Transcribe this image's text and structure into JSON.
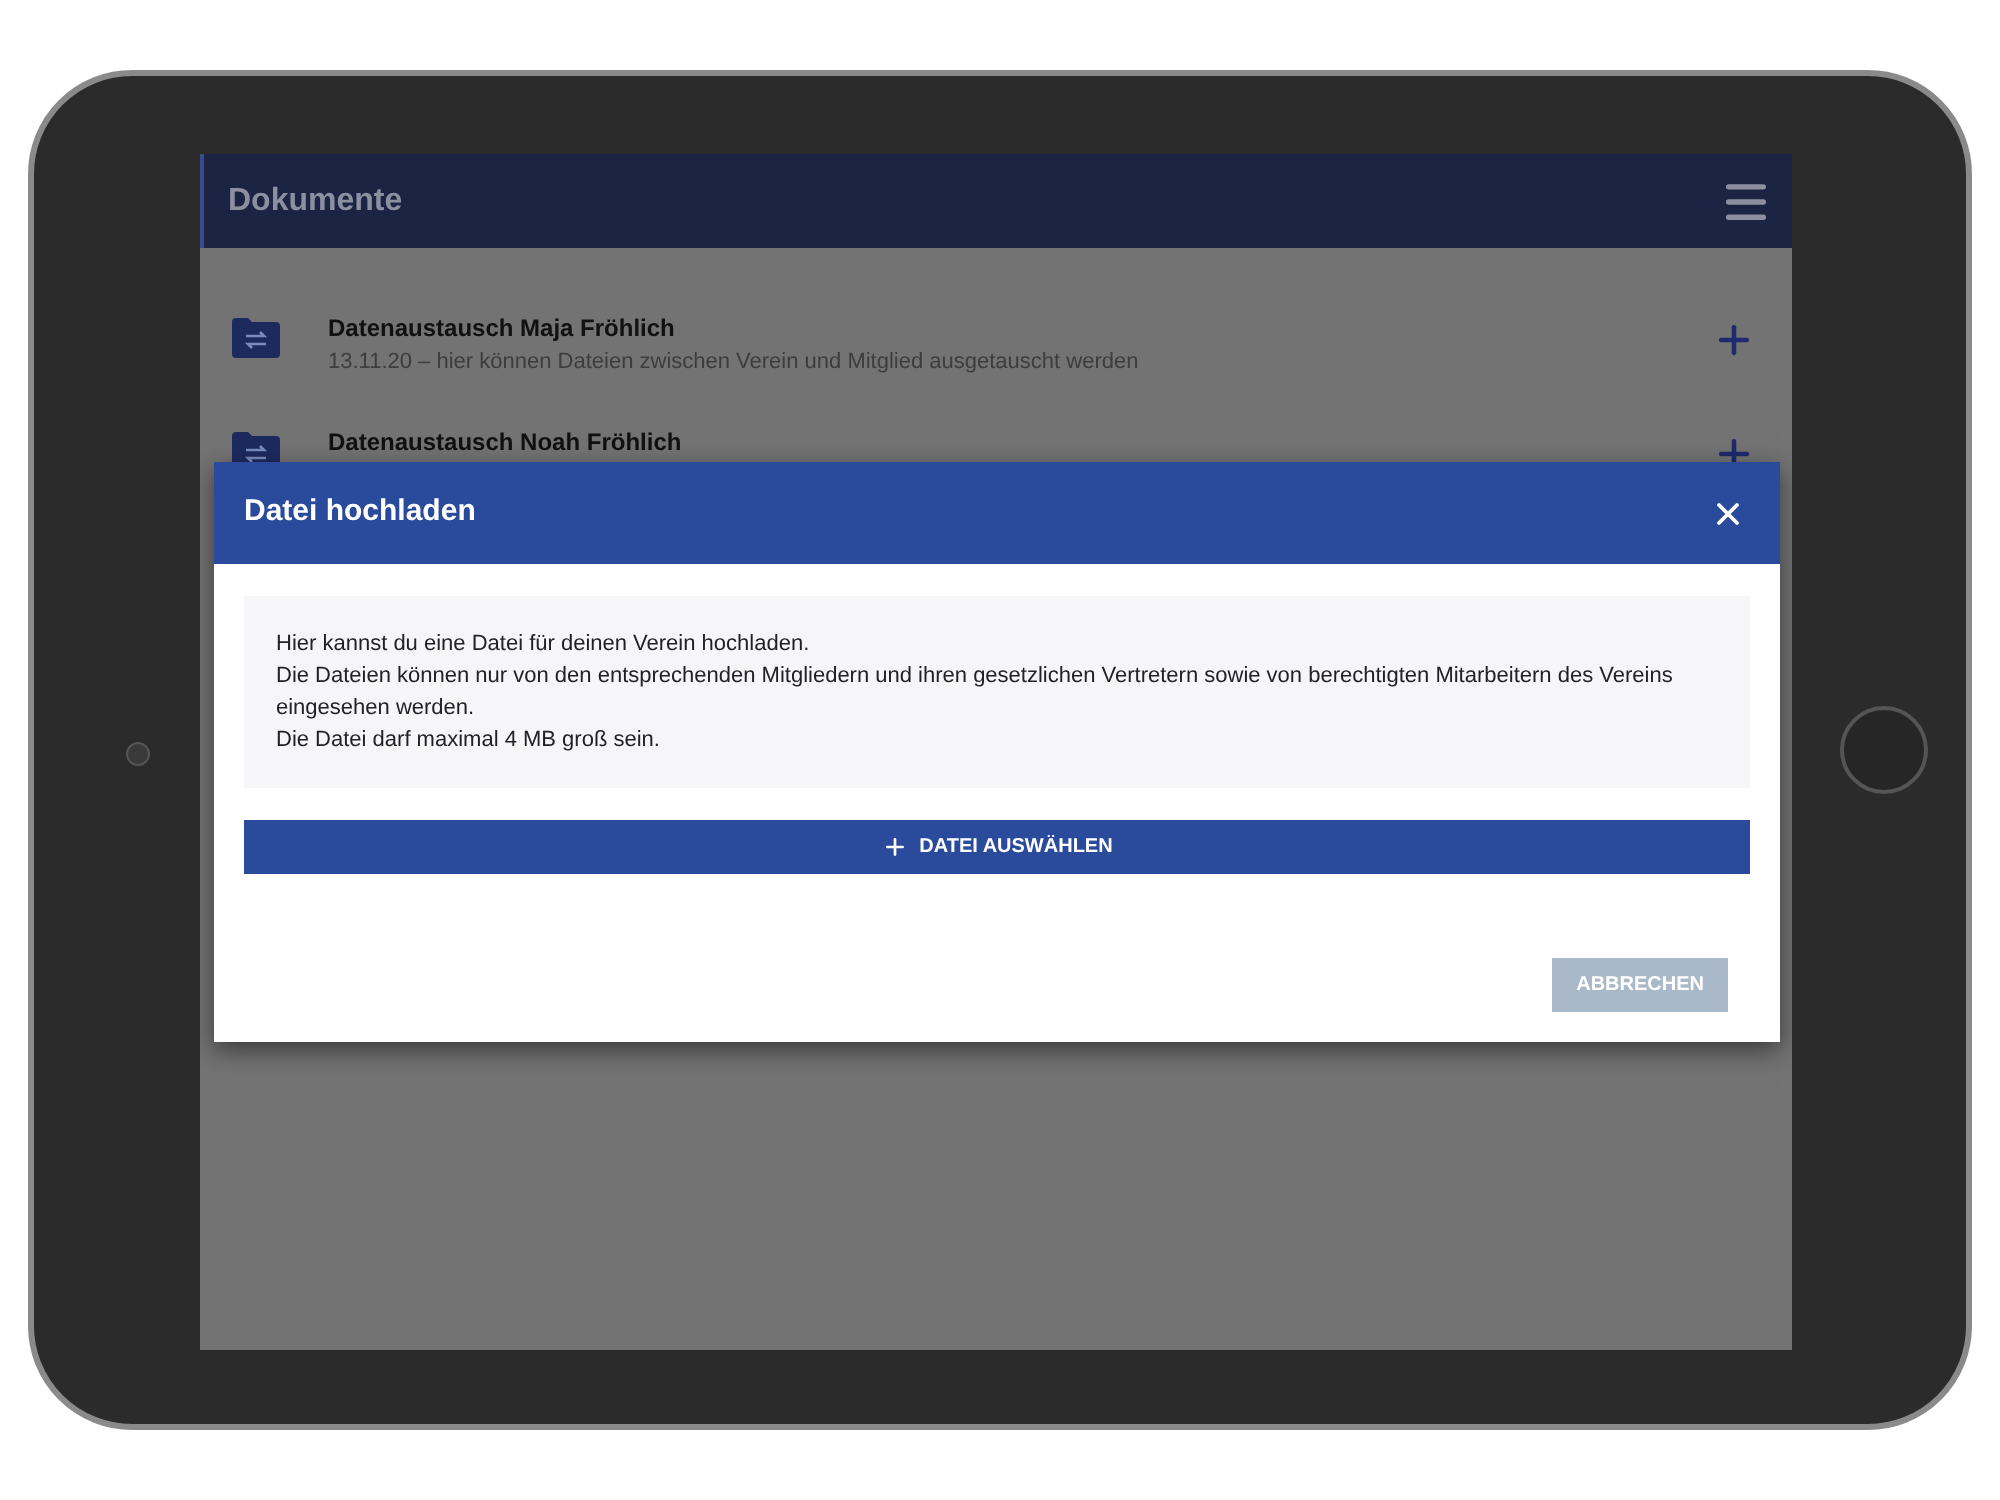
{
  "app_bar": {
    "title": "Dokumente"
  },
  "items": [
    {
      "title": "Datenaustausch Maja Fröhlich",
      "subtitle": "13.11.20 – hier können Dateien zwischen Verein und Mitglied ausgetauscht werden"
    },
    {
      "title": "Datenaustausch Noah Fröhlich"
    }
  ],
  "dialog": {
    "title": "Datei hochladen",
    "info": [
      "Hier kannst du eine Datei für deinen Verein hochladen.",
      "Die Dateien können nur von den entsprechenden Mitgliedern und ihren gesetzlichen Vertretern sowie von berechtigten Mitarbeitern des Vereins eingesehen werden.",
      "Die Datei darf maximal 4 MB groß sein."
    ],
    "select_button": "DATEI AUSWÄHLEN",
    "cancel_button": {
      "label": "ABBRECHEN",
      "disabled": true
    }
  }
}
